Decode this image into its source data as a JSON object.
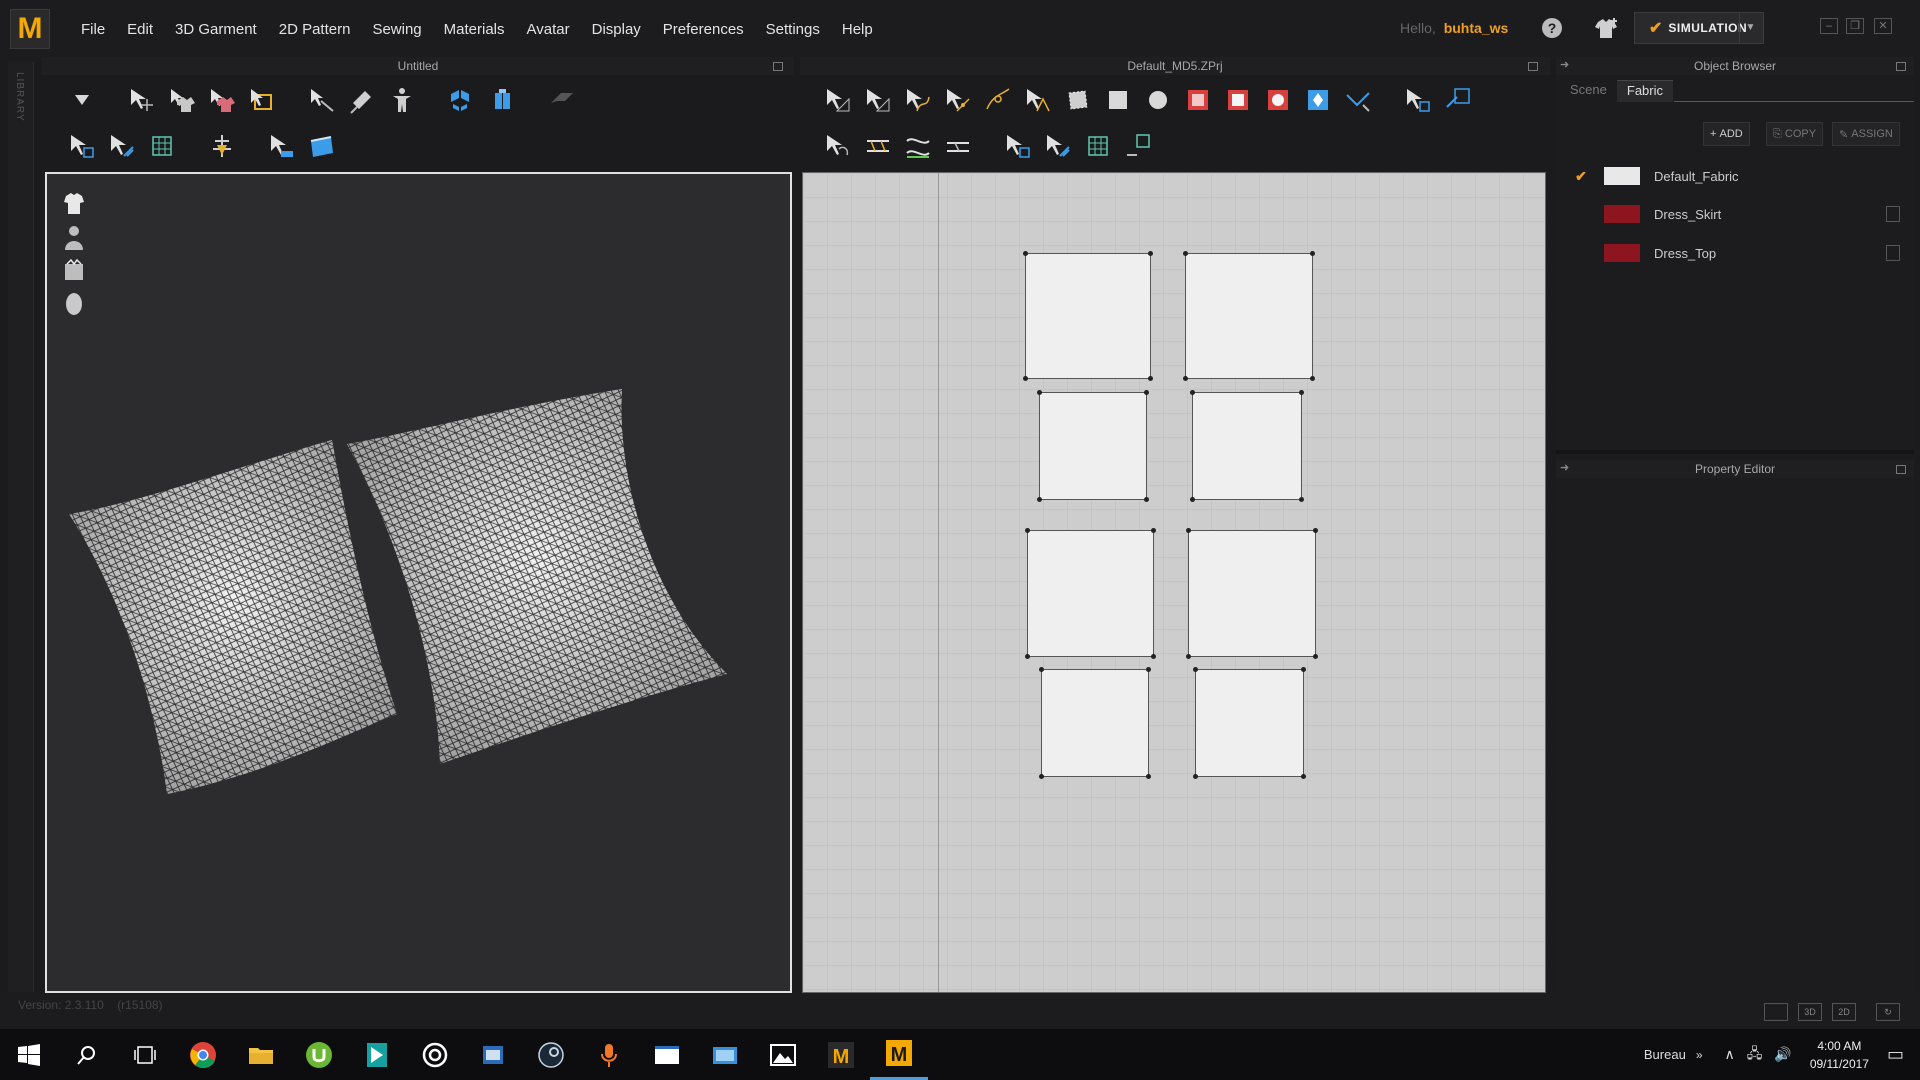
{
  "app": {
    "logo_text": "M",
    "menus": [
      "File",
      "Edit",
      "3D Garment",
      "2D Pattern",
      "Sewing",
      "Materials",
      "Avatar",
      "Display",
      "Preferences",
      "Settings",
      "Help"
    ],
    "greeting": "Hello,",
    "username": "buhta_ws",
    "simulation_label": "SIMULATION",
    "help_icon": "?",
    "accent_color": "#f0a020",
    "library_label": "LIBRARY"
  },
  "panels": {
    "viewport3d_title": "Untitled",
    "viewport2d_title": "Default_MD5.ZPrj",
    "object_browser_title": "Object Browser",
    "property_editor_title": "Property Editor"
  },
  "object_browser": {
    "tabs": [
      {
        "label": "Scene",
        "active": false
      },
      {
        "label": "Fabric",
        "active": true
      }
    ],
    "add_label": "ADD",
    "copy_label": "COPY",
    "assign_label": "ASSIGN",
    "fabrics": [
      {
        "name": "Default_Fabric",
        "color": "#e8e8e8",
        "checked": true
      },
      {
        "name": "Dress_Skirt",
        "color": "#8c1520",
        "checked": false
      },
      {
        "name": "Dress_Top",
        "color": "#8c1520",
        "checked": false
      }
    ]
  },
  "status": {
    "version": "Version: 2.3.110",
    "build": "(r15108)",
    "view_modes": [
      "",
      "3D",
      "2D"
    ]
  },
  "taskbar": {
    "desktop_label": "Bureau",
    "time": "4:00 AM",
    "date": "09/11/2017"
  }
}
